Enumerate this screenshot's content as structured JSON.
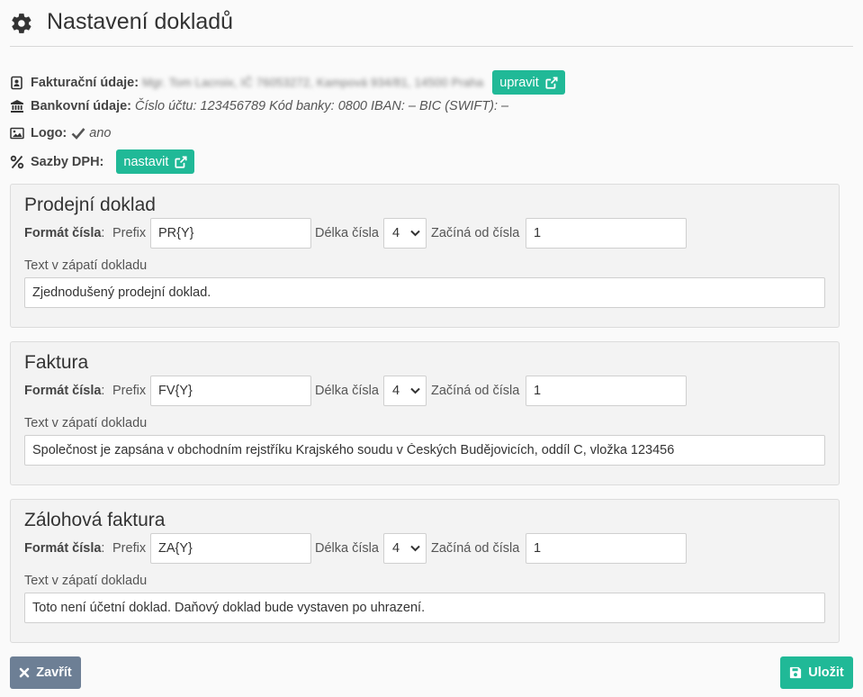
{
  "header": {
    "title": "Nastavení dokladů",
    "icon": "gear-icon"
  },
  "info": {
    "billing": {
      "label": "Fakturační údaje:",
      "value": "Mgr. Tom Lacroix, IČ 76053272, Kampová 934/81, 14500 Praha",
      "button": "upravit"
    },
    "bank": {
      "label": "Bankovní údaje:",
      "value": "Číslo účtu: 123456789 Kód banky: 0800 IBAN: – BIC (SWIFT): –"
    },
    "logo": {
      "label": "Logo:",
      "value": "ano"
    },
    "vat": {
      "label": "Sazby DPH:",
      "button": "nastavit"
    }
  },
  "common": {
    "format_label": "Formát čísla",
    "prefix_label": "Prefix",
    "length_label": "Délka čísla",
    "start_label": "Začíná od čísla",
    "footer_label": "Text v zápatí dokladu"
  },
  "sections": [
    {
      "title": "Prodejní doklad",
      "prefix": "PR{Y}",
      "length": "4",
      "start": "1",
      "footer": "Zjednodušený prodejní doklad."
    },
    {
      "title": "Faktura",
      "prefix": "FV{Y}",
      "length": "4",
      "start": "1",
      "footer": "Společnost je zapsána v obchodním rejstříku Krajského soudu v Českých Budějovicích, oddíl C, vložka 123456"
    },
    {
      "title": "Zálohová faktura",
      "prefix": "ZA{Y}",
      "length": "4",
      "start": "1",
      "footer": "Toto není účetní doklad. Daňový doklad bude vystaven po uhrazení."
    }
  ],
  "buttons": {
    "close": "Zavřít",
    "save": "Uložit"
  },
  "colors": {
    "accent": "#20b997",
    "secondary": "#6d7f95"
  }
}
